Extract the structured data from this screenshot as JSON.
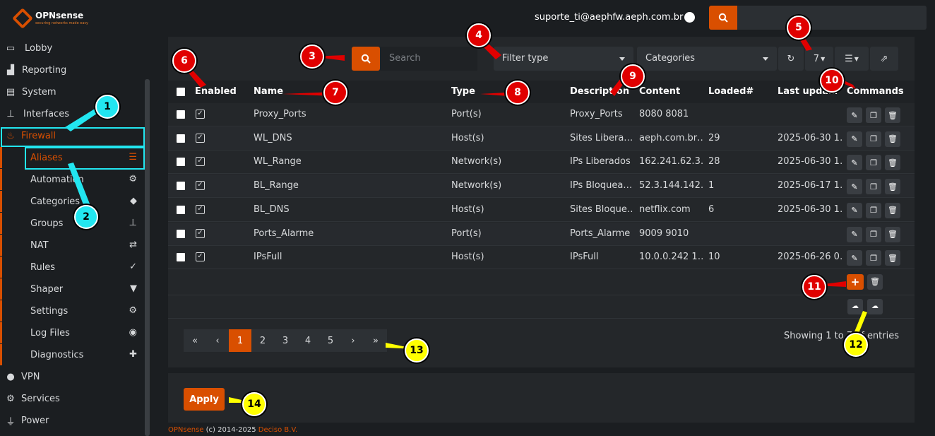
{
  "topbar": {
    "logo_name": "OPNsense",
    "logo_tagline": "securing networks made easy",
    "user": "suporte_ti@aephfw.aeph.com.br",
    "search_icon": "search-icon"
  },
  "sidebar": {
    "items": [
      {
        "label": "Lobby",
        "icon": "laptop-icon"
      },
      {
        "label": "Reporting",
        "icon": "chart-icon"
      },
      {
        "label": "System",
        "icon": "server-icon"
      },
      {
        "label": "Interfaces",
        "icon": "sitemap-icon"
      },
      {
        "label": "Firewall",
        "icon": "fire-icon"
      },
      {
        "label": "VPN",
        "icon": "globe-icon"
      },
      {
        "label": "Services",
        "icon": "gear-icon"
      },
      {
        "label": "Power",
        "icon": "plug-icon"
      }
    ],
    "firewall_sub": [
      {
        "label": "Aliases",
        "icon": "list-icon"
      },
      {
        "label": "Automation",
        "icon": "gear-icon"
      },
      {
        "label": "Categories",
        "icon": "tags-icon"
      },
      {
        "label": "Groups",
        "icon": "sitemap-icon"
      },
      {
        "label": "NAT",
        "icon": "exchange-icon"
      },
      {
        "label": "Rules",
        "icon": "check-icon"
      },
      {
        "label": "Shaper",
        "icon": "filter-icon"
      },
      {
        "label": "Settings",
        "icon": "cogs-icon"
      },
      {
        "label": "Log Files",
        "icon": "eye-icon"
      },
      {
        "label": "Diagnostics",
        "icon": "medkit-icon"
      }
    ]
  },
  "toolbar": {
    "search_placeholder": "Search",
    "filter_type": "Filter type",
    "categories": "Categories",
    "rows_per_page": "7"
  },
  "table": {
    "headers": [
      "Enabled",
      "Name",
      "Type",
      "Description",
      "Content",
      "Loaded#",
      "Last upda…",
      "Commands"
    ],
    "rows": [
      {
        "name": "Proxy_Ports",
        "type": "Port(s)",
        "description": "Proxy_Ports",
        "content": "8080 8081",
        "loaded": "",
        "updated": ""
      },
      {
        "name": "WL_DNS",
        "type": "Host(s)",
        "description": "Sites Libera…",
        "content": "aeph.com.br…",
        "loaded": "29",
        "updated": "2025-06-30 1…"
      },
      {
        "name": "WL_Range",
        "type": "Network(s)",
        "description": "IPs Liberados",
        "content": "162.241.62.3…",
        "loaded": "28",
        "updated": "2025-06-30 1…"
      },
      {
        "name": "BL_Range",
        "type": "Network(s)",
        "description": "IPs Bloquea…",
        "content": "52.3.144.142…",
        "loaded": "1",
        "updated": "2025-06-17 1…"
      },
      {
        "name": "BL_DNS",
        "type": "Host(s)",
        "description": "Sites Bloque…",
        "content": "netflix.com",
        "loaded": "6",
        "updated": "2025-06-30 1…"
      },
      {
        "name": "Ports_Alarme",
        "type": "Port(s)",
        "description": "Ports_Alarme",
        "content": "9009 9010",
        "loaded": "",
        "updated": ""
      },
      {
        "name": "IPsFull",
        "type": "Host(s)",
        "description": "IPsFull",
        "content": "10.0.0.242 1…",
        "loaded": "10",
        "updated": "2025-06-26 0…"
      }
    ]
  },
  "pager": {
    "pages": [
      "«",
      "‹",
      "1",
      "2",
      "3",
      "4",
      "5",
      "›",
      "»"
    ],
    "active": "1",
    "showing": "Showing 1 to 7 of ",
    "showing_tail": " entries"
  },
  "apply_label": "Apply",
  "footer": {
    "brand": "OPNsense",
    "copy": " (c) 2014-2025 ",
    "company": "Deciso B.V."
  },
  "annotations": [
    "1",
    "2",
    "3",
    "4",
    "5",
    "6",
    "7",
    "8",
    "9",
    "10",
    "11",
    "12",
    "13",
    "14"
  ],
  "colors": {
    "accent": "#d94f00",
    "cyan": "#22e6f0",
    "red": "#e00000",
    "yellow": "#ffff00"
  }
}
